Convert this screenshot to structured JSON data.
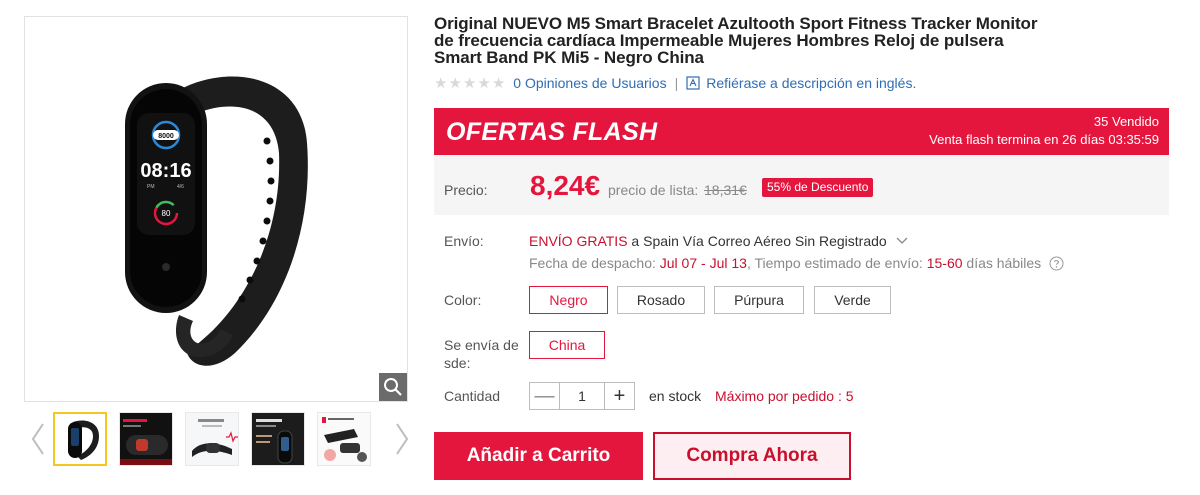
{
  "product": {
    "title": "Original NUEVO M5 Smart Bracelet Azultooth Sport Fitness Tracker Monitor de frecuencia cardíaca Impermeable Mujeres Hombres Reloj de pulsera Smart Band PK Mi5 - Negro China",
    "rating_stars": 0,
    "reviews_link": "0 Opiniones de Usuarios",
    "separator": "|",
    "english_desc_link": "Refiérase a descripción en inglés."
  },
  "gallery": {
    "main_screen": {
      "steps": "8000",
      "time": "08:16",
      "date_left": "PM",
      "date_right": "4/6",
      "heart": "80"
    },
    "thumbnails": [
      {
        "name": "thumb-black-band",
        "active": true
      },
      {
        "name": "thumb-promo-dark",
        "active": false
      },
      {
        "name": "thumb-heart-rate",
        "active": false
      },
      {
        "name": "thumb-sleep-quality",
        "active": false
      },
      {
        "name": "thumb-accessories",
        "active": false
      }
    ]
  },
  "flash_sale": {
    "title": "OFERTAS FLASH",
    "sold": "35 Vendido",
    "timer": "Venta flash termina en 26 días 03:35:59"
  },
  "price": {
    "label": "Precio:",
    "value": "8,24€",
    "list_label": "precio de lista:",
    "list_value": "18,31€",
    "discount": "55% de Descuento"
  },
  "shipping": {
    "label": "Envío:",
    "free": "ENVÍO GRATIS",
    "destination": " a Spain Vía Correo Aéreo Sin Registrado",
    "dispatch_label": "Fecha de despacho: ",
    "dispatch_dates": "Jul 07 - Jul 13",
    "estimate_label": ", Tiempo estimado de envío: ",
    "estimate_days": "15-60",
    "estimate_unit": " días hábiles"
  },
  "color": {
    "label": "Color:",
    "options": [
      "Negro",
      "Rosado",
      "Púrpura",
      "Verde"
    ],
    "selected": "Negro"
  },
  "ships_from": {
    "label_line1": "Se envía de",
    "label_line2": "sde:",
    "option": "China"
  },
  "quantity": {
    "label": "Cantidad",
    "minus": "—",
    "value": "1",
    "plus": "+",
    "stock": "en stock",
    "max": "Máximo por pedido : 5"
  },
  "actions": {
    "add_to_cart": "Añadir a Carrito",
    "buy_now": "Compra Ahora"
  },
  "colors": {
    "accent": "#e5163e",
    "dark_red": "#c8102e",
    "link": "#2f6db5",
    "thumb_active": "#f3c623"
  }
}
